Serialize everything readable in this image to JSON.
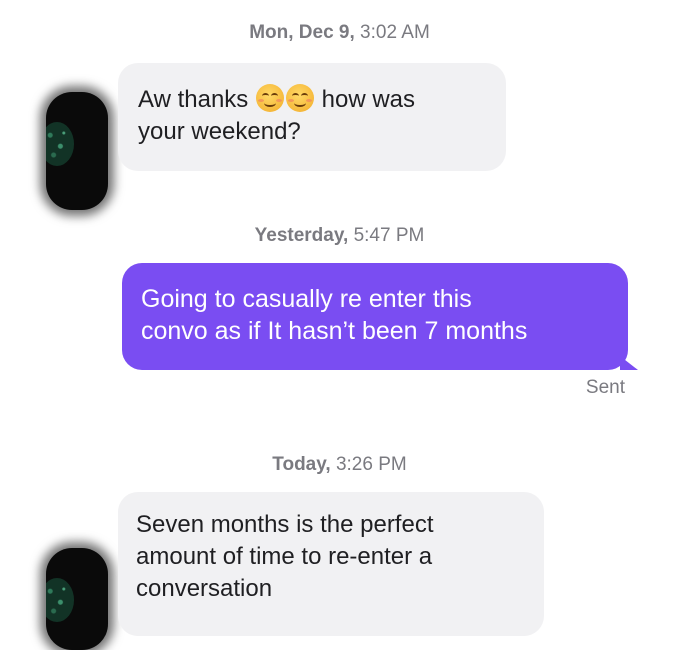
{
  "conversation": {
    "messages": [
      {
        "timestamp_day": "Mon, Dec 9,",
        "timestamp_time": " 3:02 AM",
        "direction": "incoming",
        "text_part1": "Aw thanks ",
        "emojis": [
          "relieved-face-emoji",
          "relieved-face-emoji"
        ],
        "text_part2": " how was",
        "text_line2": "your weekend?"
      },
      {
        "timestamp_day": "Yesterday,",
        "timestamp_time": " 5:47 PM",
        "direction": "outgoing",
        "text_line1": "Going to casually re enter this",
        "text_line2": "convo as if It hasn’t been 7 months",
        "status": "Sent"
      },
      {
        "timestamp_day": "Today,",
        "timestamp_time": " 3:26 PM",
        "direction": "incoming",
        "text_line1": "Seven months is the perfect",
        "text_line2": "amount of time to re-enter a",
        "text_line3": "conversation"
      }
    ]
  },
  "colors": {
    "outgoing_bubble": "#7a4df2",
    "incoming_bubble": "#f1f1f3",
    "timestamp_text": "#7a7a80"
  }
}
